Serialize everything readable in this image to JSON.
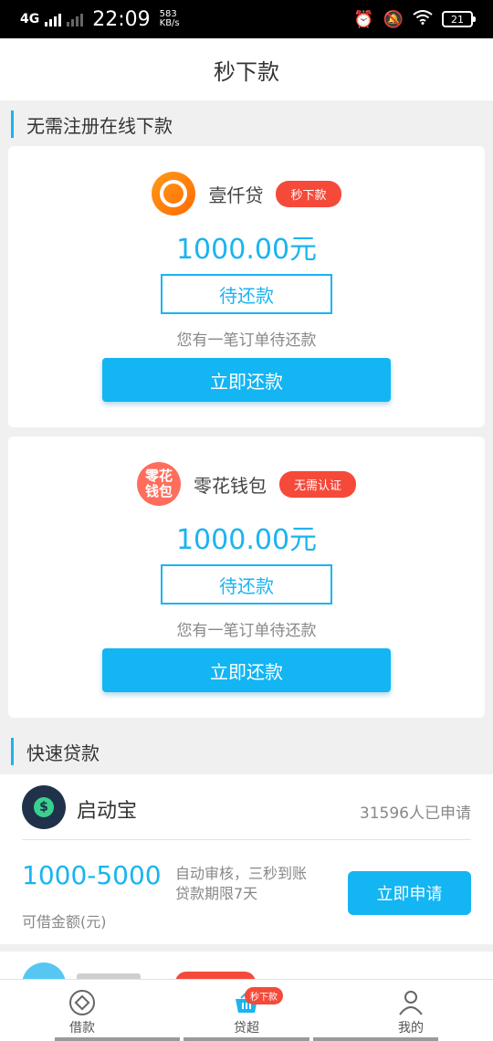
{
  "status_bar": {
    "network": "4G",
    "time": "22:09",
    "speed_value": "583",
    "speed_unit": "KB/s",
    "battery": "21"
  },
  "header": {
    "title": "秒下款"
  },
  "section_online": {
    "title": "无需注册在线下款"
  },
  "loans": [
    {
      "name": "壹仟贷",
      "tag": "秒下款",
      "amount": "1000.00元",
      "status": "待还款",
      "notice": "您有一笔订单待还款",
      "button": "立即还款",
      "logo_color": "#ff7a00"
    },
    {
      "name": "零花钱包",
      "tag": "无需认证",
      "amount": "1000.00元",
      "status": "待还款",
      "notice": "您有一笔订单待还款",
      "button": "立即还款",
      "logo_text_top": "零花",
      "logo_text_bottom": "钱包",
      "logo_color": "#ff6d5c"
    }
  ],
  "section_quick": {
    "title": "快速贷款"
  },
  "quick_loans": [
    {
      "name": "启动宝",
      "applicants": "31596人已申请",
      "range": "1000-5000",
      "desc_line1": "自动审核，三秒到账",
      "desc_line2": "贷款期限7天",
      "range_label": "可借金额(元)",
      "button": "立即申请"
    }
  ],
  "bottom_nav": {
    "items": [
      {
        "label": "借款",
        "icon": "loan-icon"
      },
      {
        "label": "贷超",
        "icon": "basket-icon",
        "badge": "秒下款"
      },
      {
        "label": "我的",
        "icon": "user-icon"
      }
    ]
  },
  "colors": {
    "accent": "#13b5f2",
    "tag": "#f54a3a"
  }
}
